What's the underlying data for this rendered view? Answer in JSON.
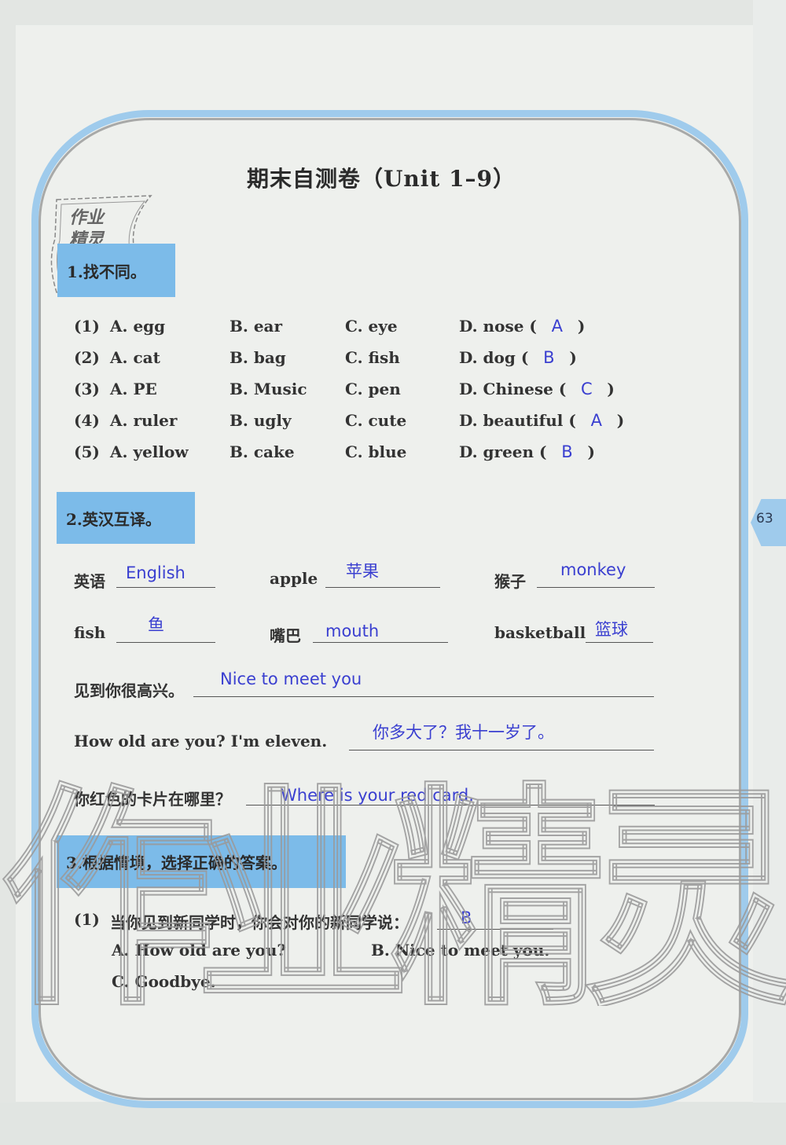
{
  "title": "期末自测卷（Unit 1–9）",
  "logo_text": "作业精灵",
  "page_number": "63",
  "colors": {
    "section_header_bg": "#7cbbe9",
    "frame_blue": "#9fcbec",
    "answer_ink": "#3a3fd0",
    "text": "#333333"
  },
  "section1": {
    "heading": "1.找不同。",
    "questions": [
      {
        "num": "(1)",
        "A": "A. egg",
        "B": "B. ear",
        "C": "C. eye",
        "D": "D. nose",
        "answer": "A"
      },
      {
        "num": "(2)",
        "A": "A. cat",
        "B": "B. bag",
        "C": "C. fish",
        "D": "D. dog",
        "answer": "B"
      },
      {
        "num": "(3)",
        "A": "A. PE",
        "B": "B. Music",
        "C": "C. pen",
        "D": "D. Chinese",
        "answer": "C"
      },
      {
        "num": "(4)",
        "A": "A. ruler",
        "B": "B. ugly",
        "C": "C. cute",
        "D": "D. beautiful",
        "answer": "A"
      },
      {
        "num": "(5)",
        "A": "A. yellow",
        "B": "B. cake",
        "C": "C. blue",
        "D": "D. green",
        "answer": "B"
      }
    ],
    "paren_open": "(",
    "paren_close": ")"
  },
  "section2": {
    "heading": "2.英汉互译。",
    "items": [
      {
        "prompt": "英语",
        "answer": "English"
      },
      {
        "prompt": "apple",
        "answer": "苹果"
      },
      {
        "prompt": "猴子",
        "answer": "monkey"
      },
      {
        "prompt": "fish",
        "answer": "鱼"
      },
      {
        "prompt": "嘴巴",
        "answer": "mouth"
      },
      {
        "prompt": "basketball",
        "answer": "篮球"
      },
      {
        "prompt": "见到你很高兴。",
        "answer": "Nice to meet you"
      },
      {
        "prompt": "How old are you? I'm eleven.",
        "answer": "你多大了？我十一岁了。"
      },
      {
        "prompt": "你红色的卡片在哪里？",
        "answer": "Where is your red card."
      }
    ]
  },
  "section3": {
    "heading": "3.根据情境，选择正确的答案。",
    "questions": [
      {
        "num": "(1)",
        "prompt": "当你见到新同学时，你会对你的新同学说：",
        "answer": "B",
        "options": [
          "A. How old are you?",
          "B. Nice to meet you.",
          "C. Goodbye."
        ]
      }
    ]
  }
}
